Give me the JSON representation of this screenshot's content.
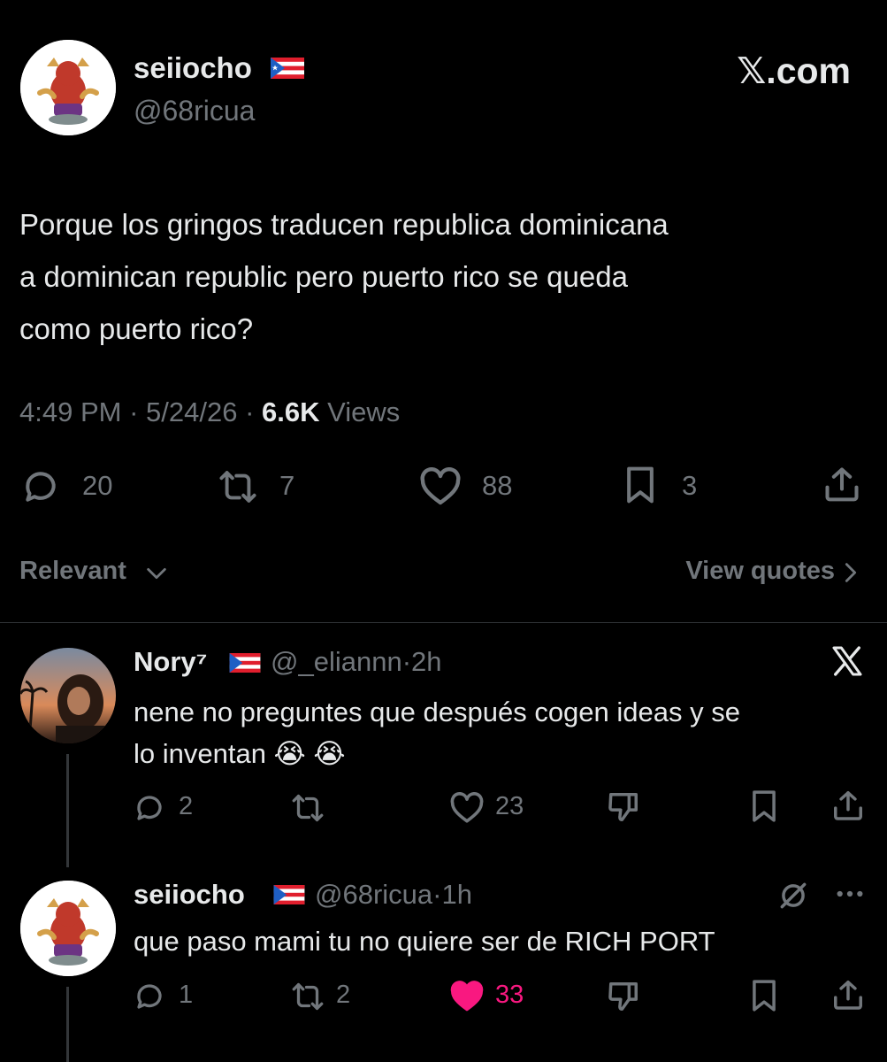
{
  "main_tweet": {
    "display_name": "seiiocho",
    "handle": "@68ricua",
    "watermark": "𝕏.com",
    "text_lines": [
      "Porque los gringos traducen republica dominicana",
      "a dominican republic pero puerto rico se queda",
      "como puerto rico?"
    ],
    "time": "4:49 PM",
    "date": "5/24/26",
    "views_count": "6.6K",
    "views_label": "Views",
    "separator": "·",
    "counts": {
      "replies": "20",
      "reposts": "7",
      "likes": "88",
      "bookmarks": "3"
    }
  },
  "sort_bar": {
    "relevant_label": "Relevant",
    "view_quotes_label": "View quotes"
  },
  "replies": [
    {
      "display_name": "Nory⁷",
      "handle": "@_eliannn",
      "time": "2h",
      "text_lines": [
        "nene no preguntes que después cogen ideas y se",
        "lo inventan 😭 😭"
      ],
      "counts": {
        "replies": "2",
        "reposts": "",
        "likes": "23"
      }
    },
    {
      "display_name": "seiiocho",
      "handle": "@68ricua",
      "time": "1h",
      "text_lines": [
        "que paso mami tu no quiere ser de RICH PORT"
      ],
      "counts": {
        "replies": "1",
        "reposts": "2",
        "likes": "33"
      }
    }
  ],
  "colors": {
    "background": "#000000",
    "text": "#e7e9ea",
    "muted": "#71767b",
    "like_active": "#f91880"
  }
}
